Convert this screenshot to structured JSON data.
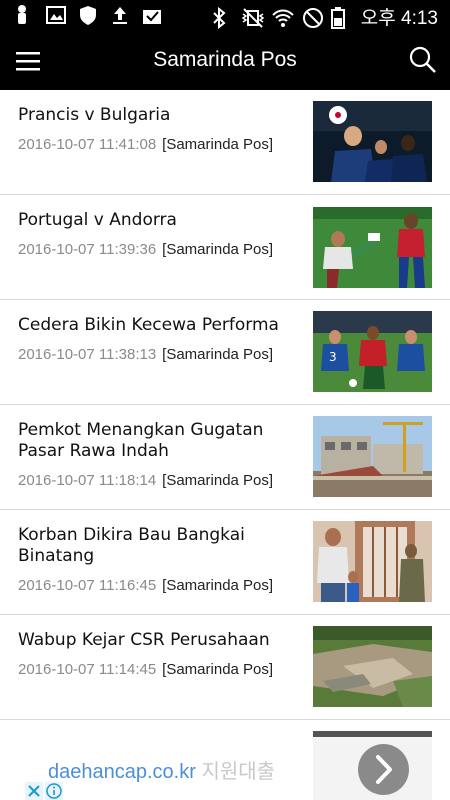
{
  "status_bar": {
    "time": "오후 4:13",
    "icons": [
      "notification-icon",
      "image-icon",
      "shield-icon",
      "upload-icon",
      "mail-check-icon",
      "bluetooth-icon",
      "vibrate-icon",
      "wifi-icon",
      "block-icon",
      "battery-icon"
    ]
  },
  "app_bar": {
    "title": "Samarinda Pos",
    "menu_icon": "hamburger-menu-icon",
    "search_icon": "search-icon"
  },
  "articles": [
    {
      "title": "Prancis v Bulgaria",
      "date": "2016-10-07 11:41:08",
      "source": "[Samarinda Pos]",
      "image": "soccer-players-blue-jerseys"
    },
    {
      "title": "Portugal v Andorra",
      "date": "2016-10-07 11:39:36",
      "source": "[Samarinda Pos]",
      "image": "soccer-players-green-kick"
    },
    {
      "title": "Cedera Bikin Kecewa Performa",
      "date": "2016-10-07 11:38:13",
      "source": "[Samarinda Pos]",
      "image": "soccer-match-tackle"
    },
    {
      "title": "Pemkot Menangkan Gugatan Pasar Rawa Indah",
      "date": "2016-10-07 11:18:14",
      "source": "[Samarinda Pos]",
      "image": "construction-site-crane"
    },
    {
      "title": "Korban Dikira Bau Bangkai Binatang",
      "date": "2016-10-07 11:16:45",
      "source": "[Samarinda Pos]",
      "image": "people-at-doorway"
    },
    {
      "title": "Wabup Kejar CSR Perusahaan",
      "date": "2016-10-07 11:14:45",
      "source": "[Samarinda Pos]",
      "image": "aerial-mining-site"
    },
    {
      "title": "",
      "date": "",
      "source": "",
      "image": "partial-thumbnail"
    }
  ],
  "ad": {
    "link_text": "daehancap.co.kr",
    "faded_text": "지원대출",
    "next_icon": "chevron-right-icon",
    "close_icon": "close-icon",
    "info_icon": "info-icon"
  }
}
